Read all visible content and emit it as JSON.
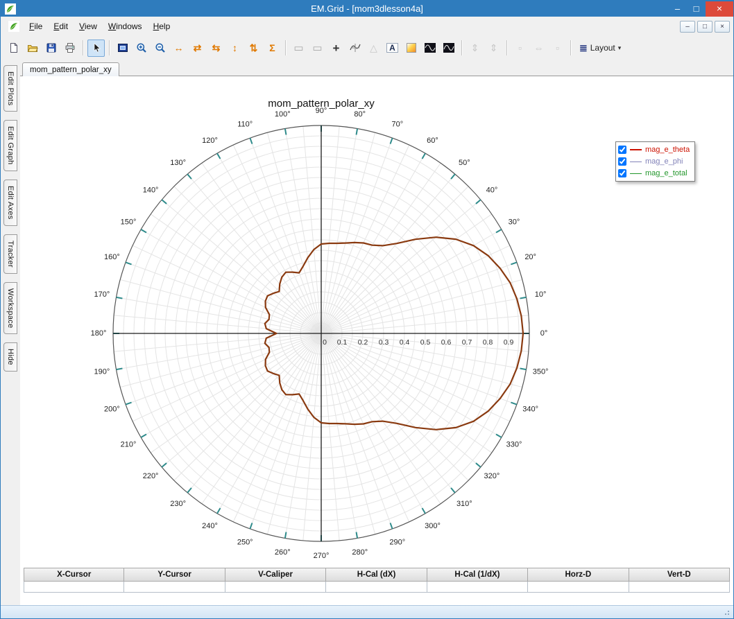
{
  "window": {
    "title": "EM.Grid - [mom3dlesson4a]",
    "controls": {
      "minimize_glyph": "–",
      "maximize_glyph": "□",
      "close_glyph": "×"
    }
  },
  "menu": {
    "items": [
      "File",
      "Edit",
      "View",
      "Windows",
      "Help"
    ]
  },
  "toolbar": {
    "active": "pointer",
    "layout_label": "Layout",
    "groups": [
      [
        "new",
        "open",
        "save",
        "print"
      ],
      [
        "pointer"
      ],
      [
        "zoom-window",
        "zoom-in",
        "zoom-out",
        "expand-x",
        "scroll-x",
        "compress-x",
        "expand-y",
        "scroll-y",
        "autoscale"
      ],
      [
        "select-rect",
        "zoom-rect",
        "crosshair",
        "tracker",
        "triangle-annotation",
        "text-annotation",
        "page-color",
        "graph-dark-1",
        "graph-dark-2"
      ],
      [
        "fit-height",
        "fit-height-alt"
      ],
      [
        "grid-left",
        "fit-width",
        "grid-right"
      ],
      [
        "layout"
      ]
    ],
    "disabled": [
      "triangle-annotation",
      "fit-height",
      "fit-height-alt",
      "grid-left",
      "fit-width",
      "grid-right"
    ]
  },
  "sidebar": {
    "items": [
      "Edit Plots",
      "Edit Graph",
      "Edit Axes",
      "Tracker",
      "Workspace",
      "Hide"
    ]
  },
  "tabs": [
    {
      "label": "mom_pattern_polar_xy"
    }
  ],
  "readout": {
    "headers": [
      "X-Cursor",
      "Y-Cursor",
      "V-Caliper",
      "H-Cal (dX)",
      "H-Cal (1/dX)",
      "Horz-D",
      "Vert-D"
    ],
    "values": [
      "",
      "",
      "",
      "",
      "",
      "",
      ""
    ]
  },
  "chart_data": {
    "type": "polar-line",
    "title": "mom_pattern_polar_xy",
    "rmax": 1,
    "angle_labels": [
      "0°",
      "10°",
      "20°",
      "30°",
      "40°",
      "50°",
      "60°",
      "70°",
      "80°",
      "90°",
      "100°",
      "110°",
      "120°",
      "130°",
      "140°",
      "150°",
      "160°",
      "170°",
      "180°",
      "190°",
      "200°",
      "210°",
      "220°",
      "230°",
      "240°",
      "250°",
      "260°",
      "270°",
      "280°",
      "290°",
      "300°",
      "310°",
      "320°",
      "330°",
      "340°",
      "350°"
    ],
    "radial_labels": [
      "0",
      "0.1",
      "0.2",
      "0.3",
      "0.4",
      "0.5",
      "0.6",
      "0.7",
      "0.8",
      "0.9"
    ],
    "grid": {
      "circle_step": 0.05,
      "spoke_step_deg": 5,
      "tick_step_deg": 10
    },
    "legend": {
      "position": "top-right",
      "entries": [
        {
          "label": "mag_e_theta",
          "color": "#cc1100",
          "line_width": 2,
          "checked": true
        },
        {
          "label": "mag_e_phi",
          "color": "#8282b8",
          "line_width": 1,
          "checked": true
        },
        {
          "label": "mag_e_total",
          "color": "#21962a",
          "line_width": 1,
          "checked": true
        }
      ]
    },
    "curve": {
      "name": "mag_e_theta / mag_e_total (overlaid)",
      "color": "#8a3a10",
      "angles_deg": [
        0,
        5,
        10,
        15,
        20,
        25,
        30,
        35,
        40,
        45,
        50,
        55,
        60,
        65,
        70,
        75,
        80,
        85,
        90,
        95,
        100,
        105,
        110,
        115,
        120,
        125,
        130,
        135,
        140,
        145,
        150,
        155,
        160,
        165,
        170,
        175,
        180,
        185,
        190,
        195,
        200,
        205,
        210,
        215,
        220,
        225,
        230,
        235,
        240,
        245,
        250,
        255,
        260,
        265,
        270,
        275,
        280,
        285,
        290,
        295,
        300,
        305,
        310,
        315,
        320,
        325,
        330,
        335,
        340,
        345,
        350,
        355,
        360
      ],
      "r": [
        0.97,
        0.965,
        0.955,
        0.94,
        0.915,
        0.885,
        0.845,
        0.79,
        0.72,
        0.64,
        0.565,
        0.515,
        0.49,
        0.48,
        0.465,
        0.45,
        0.44,
        0.435,
        0.43,
        0.405,
        0.37,
        0.335,
        0.31,
        0.325,
        0.34,
        0.33,
        0.31,
        0.285,
        0.3,
        0.315,
        0.31,
        0.295,
        0.265,
        0.26,
        0.275,
        0.265,
        0.215,
        0.265,
        0.275,
        0.26,
        0.265,
        0.295,
        0.31,
        0.315,
        0.3,
        0.285,
        0.31,
        0.33,
        0.34,
        0.325,
        0.31,
        0.335,
        0.37,
        0.405,
        0.43,
        0.435,
        0.44,
        0.45,
        0.465,
        0.48,
        0.49,
        0.515,
        0.565,
        0.64,
        0.72,
        0.79,
        0.845,
        0.885,
        0.915,
        0.94,
        0.955,
        0.965,
        0.97
      ]
    }
  },
  "colors": {
    "titlebar": "#2f7cbd",
    "close_button": "#dd4a3a",
    "tick_teal": "#2e8b8b",
    "axis": "#1a1a1a",
    "grid": "#e4e4e4",
    "outer_circle": "#555555"
  }
}
